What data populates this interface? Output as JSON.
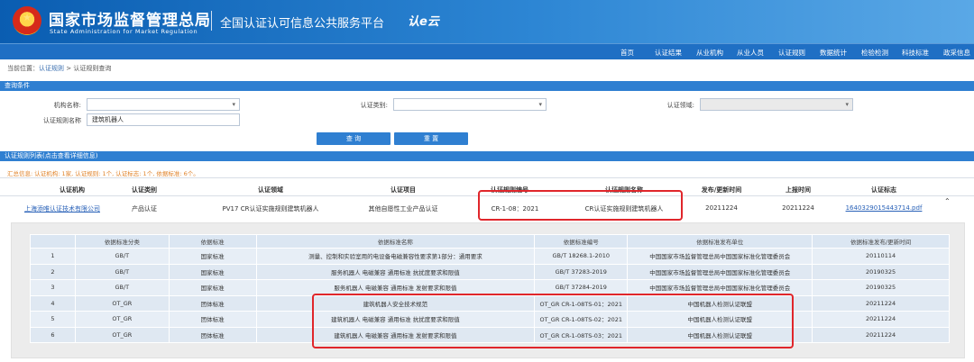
{
  "header": {
    "org_cn": "国家市场监督管理总局",
    "org_en": "State Administration  for  Market Regulation",
    "platform": "全国认证认可信息公共服务平台",
    "logo_mark": "认e云"
  },
  "nav": [
    "首页",
    "认证结果",
    "从业机构",
    "从业人员",
    "认证规则",
    "数据统计",
    "检验检测",
    "科技标准",
    "政采信息"
  ],
  "breadcrumb": {
    "prefix": "当前位置：",
    "level1": "认证规则",
    "sep": " > ",
    "level2": "认证规则查询"
  },
  "query": {
    "section_title": "查询条件",
    "org_label": "机构名称:",
    "type_label": "认证类别:",
    "field_label": "认证领域:",
    "rule_name_label": "认证规则名称",
    "rule_name_value": "建筑机器人",
    "search_button": "查 询",
    "reset_button": "重 置"
  },
  "results": {
    "section_title": "认证规则列表(点击查看详细信息)",
    "summary": "汇总信息: 认证机构: 1家, 认证规则: 1个, 认证标志: 1个, 依据标准: 6个。",
    "columns": [
      "认证机构",
      "认证类别",
      "认证领域",
      "认证项目",
      "认证规则编号",
      "认证规则名称",
      "发布/更新时间",
      "上报时间",
      "认证标志"
    ],
    "row": {
      "org": "上海添唯认证技术有限公司",
      "type": "产品认证",
      "field": "PV17 CR认证实施规则建筑机器人",
      "item": "其他自愿性工业产品认证",
      "rule_no": "CR-1-08：2021",
      "rule_name": "CR认证实施规则建筑机器人",
      "publish_date": "20211224",
      "report_date": "20211224",
      "mark": "1640329015443714.pdf"
    }
  },
  "detail": {
    "columns": [
      "",
      "依据标准分类",
      "依据标准",
      "依据标准名称",
      "依据标准编号",
      "依据标准发布单位",
      "依据标准发布/更新时间"
    ],
    "rows": [
      [
        "1",
        "GB/T",
        "国家标准",
        "测量、控制和实验室用的电设备电磁兼容性要求第1部分：通用要求",
        "GB/T 18268.1-2010",
        "中国国家市场监督管理总局中国国家标准化管理委员会",
        "20110114"
      ],
      [
        "2",
        "GB/T",
        "国家标准",
        "服务机器人 电磁兼容 通用标准 抗扰度要求和限值",
        "GB/T 37283-2019",
        "中国国家市场监督管理总局中国国家标准化管理委员会",
        "20190325"
      ],
      [
        "3",
        "GB/T",
        "国家标准",
        "服务机器人 电磁兼容 通用标准 发射要求和限值",
        "GB/T 37284-2019",
        "中国国家市场监督管理总局中国国家标准化管理委员会",
        "20190325"
      ],
      [
        "4",
        "OT_GR",
        "团体标准",
        "建筑机器人安全技术规范",
        "OT_GR CR-1-08TS-01：2021",
        "中国机器人检测认证联盟",
        "20211224"
      ],
      [
        "5",
        "OT_GR",
        "团体标准",
        "建筑机器人 电磁兼容 通用标准 抗扰度要求和限值",
        "OT_GR CR-1-08TS-02：2021",
        "中国机器人检测认证联盟",
        "20211224"
      ],
      [
        "6",
        "OT_GR",
        "团体标准",
        "建筑机器人 电磁兼容 通用标准 发射要求和限值",
        "OT_GR CR-1-08TS-03：2021",
        "中国机器人检测认证联盟",
        "20211224"
      ]
    ]
  },
  "colors": {
    "header_blue": "#1f6fc4",
    "section_blue": "#2f7fd1",
    "summary_orange": "#e0832a",
    "annotation_red": "#e0262b"
  }
}
